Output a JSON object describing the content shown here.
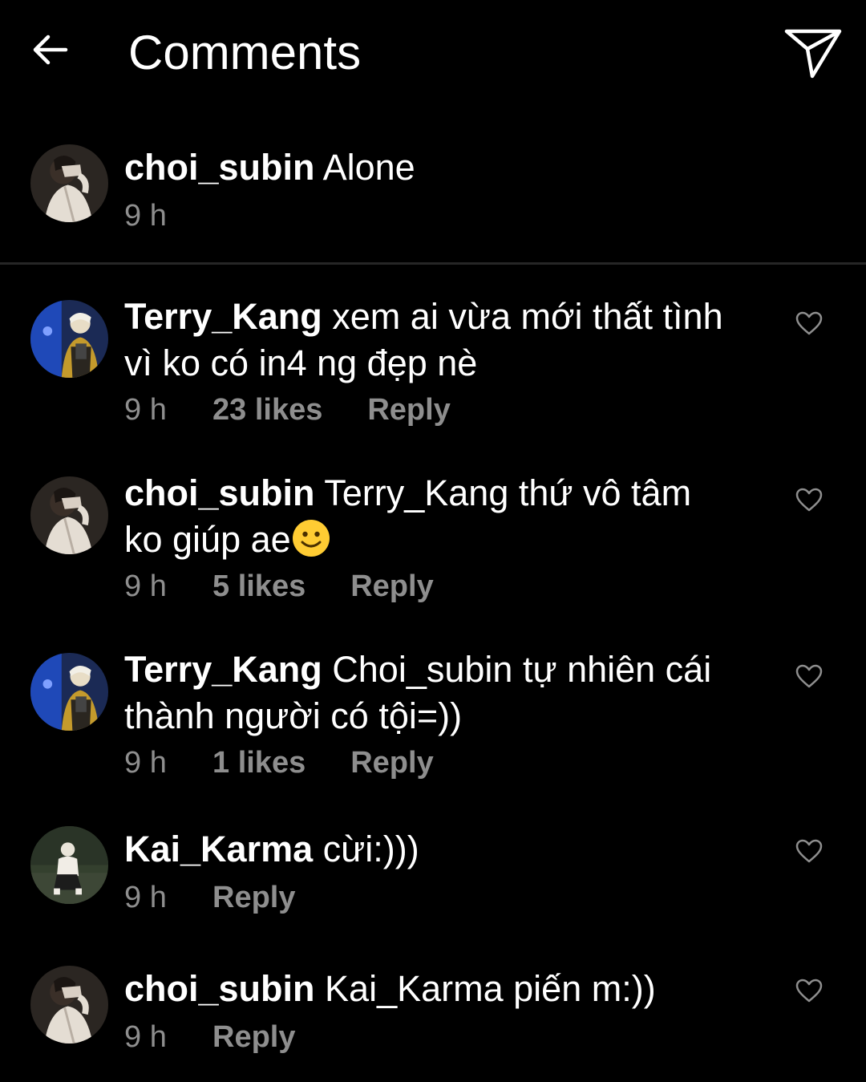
{
  "header": {
    "title": "Comments",
    "back_icon": "arrow-left-icon",
    "share_icon": "send-icon"
  },
  "caption": {
    "username": "choi_subin",
    "text": "Alone",
    "time": "9 h"
  },
  "comments": [
    {
      "username": "Terry_Kang",
      "text": "xem ai vừa mới thất tình\nvì ko có in4 ng đẹp nè",
      "time": "9 h",
      "likes": "23 likes",
      "reply": "Reply"
    },
    {
      "username": "choi_subin",
      "text": "Terry_Kang thứ vô tâm\nko giúp ae",
      "emoji": "slightly-smiling-face-emoji",
      "time": "9 h",
      "likes": "5 likes",
      "reply": "Reply"
    },
    {
      "username": "Terry_Kang",
      "text": "Choi_subin tự nhiên cái\nthành người có tội=))",
      "time": "9 h",
      "likes": "1 likes",
      "reply": "Reply"
    },
    {
      "username": "Kai_Karma",
      "text": "cừi:)))",
      "time": "9 h",
      "reply": "Reply"
    },
    {
      "username": "choi_subin",
      "text": "Kai_Karma piến m:))",
      "time": "9 h",
      "reply": "Reply"
    }
  ],
  "colors": {
    "background": "#000000",
    "primary_text": "#ffffff",
    "secondary_text": "#8e8e8e",
    "divider": "#262626"
  }
}
